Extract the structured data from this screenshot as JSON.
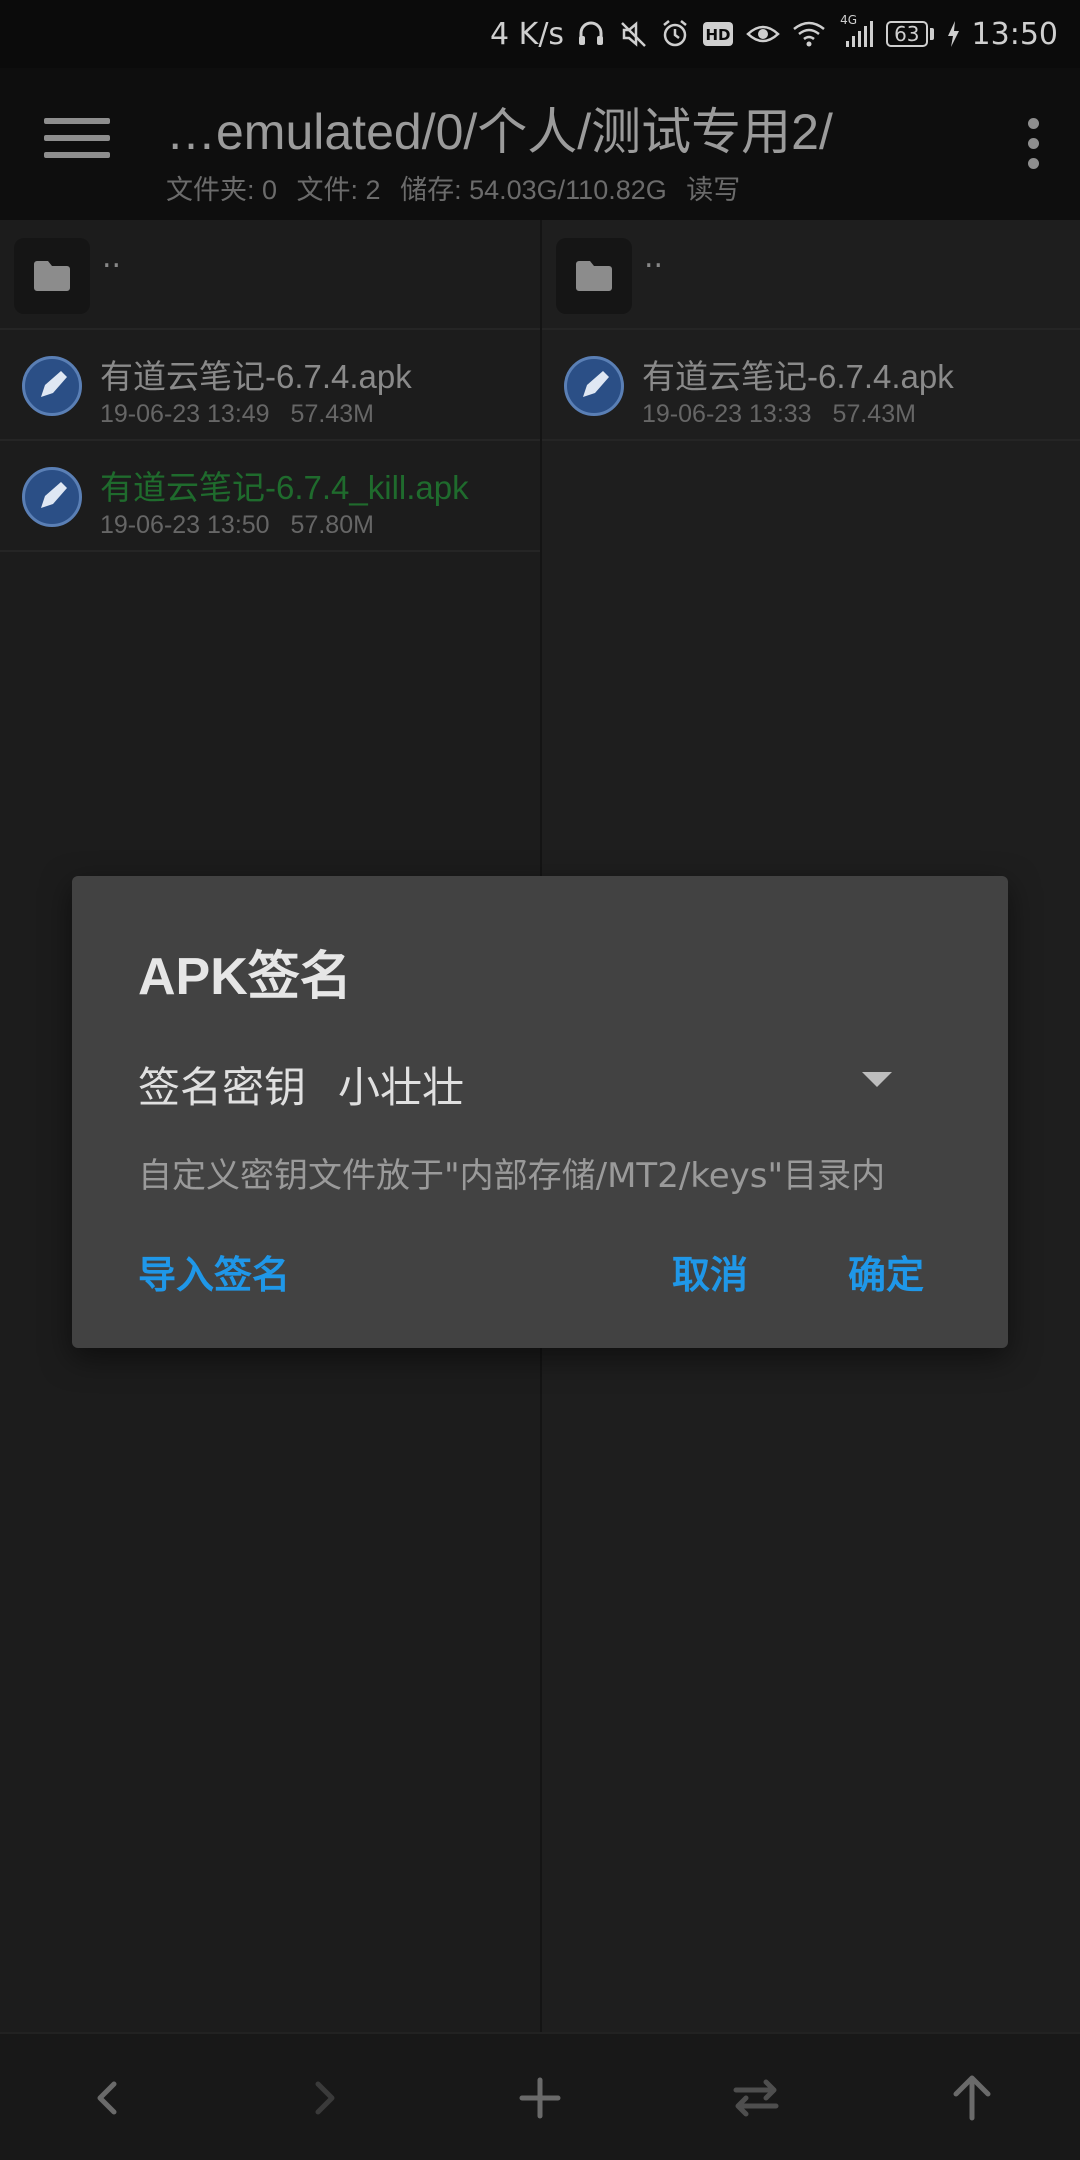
{
  "status_bar": {
    "net_speed": "4 K/s",
    "network_type": "4G",
    "battery": "63",
    "time": "13:50",
    "icons": [
      "headset-icon",
      "mute-icon",
      "alarm-icon",
      "hd-icon",
      "eye-icon",
      "wifi-icon",
      "signal-icon",
      "battery-icon",
      "charging-icon"
    ]
  },
  "toolbar": {
    "path": "…emulated/0/个人/测试专用2/",
    "folders": "文件夹: 0",
    "files": "文件: 2",
    "storage": "储存: 54.03G/110.82G",
    "mode": "读写"
  },
  "left_pane": {
    "parent_label": "..",
    "files": [
      {
        "name": "有道云笔记-6.7.4.apk",
        "date": "19-06-23 13:49",
        "size": "57.43M",
        "highlight": false
      },
      {
        "name": "有道云笔记-6.7.4_kill.apk",
        "date": "19-06-23 13:50",
        "size": "57.80M",
        "highlight": true
      }
    ]
  },
  "right_pane": {
    "parent_label": "..",
    "files": [
      {
        "name": "有道云笔记-6.7.4.apk",
        "date": "19-06-23 13:33",
        "size": "57.43M",
        "highlight": false
      }
    ]
  },
  "dialog": {
    "title": "APK签名",
    "key_label": "签名密钥",
    "key_value": "小壮壮",
    "hint": "自定义密钥文件放于\"内部存储/MT2/keys\"目录内",
    "import_label": "导入签名",
    "cancel_label": "取消",
    "ok_label": "确定"
  },
  "colors": {
    "accent": "#1f97e8",
    "highlight_file": "#1f6b2d",
    "dialog_bg": "#424242"
  },
  "bottom_bar": {
    "icons": [
      "back-icon",
      "forward-icon",
      "add-icon",
      "swap-icon",
      "up-icon"
    ]
  }
}
